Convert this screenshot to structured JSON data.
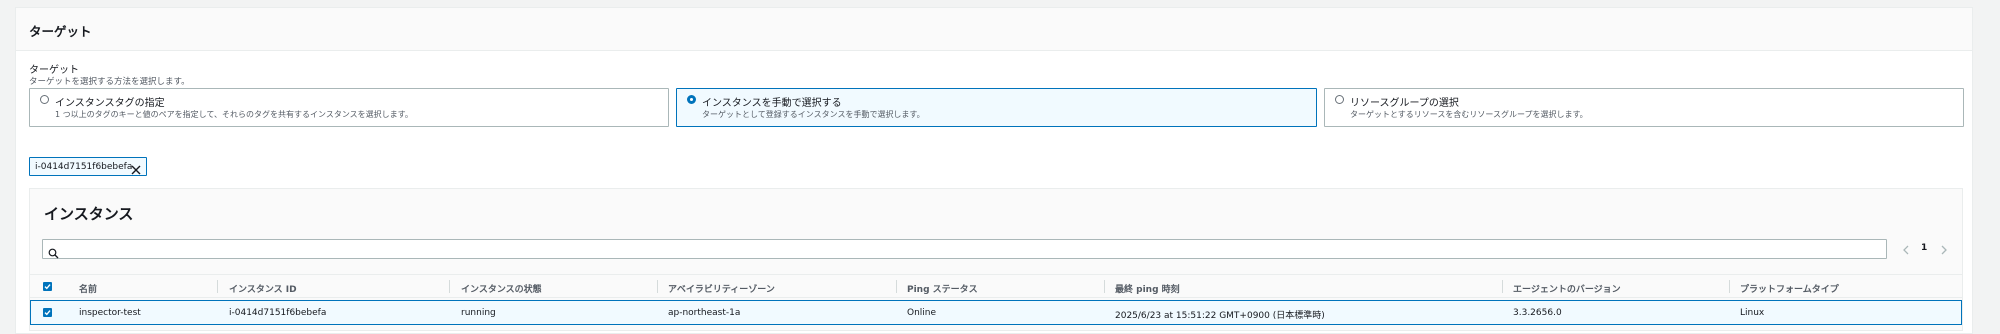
{
  "section": {
    "title": "ターゲット",
    "field_label": "ターゲット",
    "field_description": "ターゲットを選択する方法を選択します。"
  },
  "target_options": [
    {
      "label": "インスタンスタグの指定",
      "description": "1 つ以上のタグのキーと値のペアを指定して、それらのタグを共有するインスタンスを選択します。",
      "selected": false
    },
    {
      "label": "インスタンスを手動で選択する",
      "description": "ターゲットとして登録するインスタンスを手動で選択します。",
      "selected": true
    },
    {
      "label": "リソースグループの選択",
      "description": "ターゲットとするリソースを含むリソースグループを選択します。",
      "selected": false
    }
  ],
  "selected_token": {
    "label": "i-0414d7151f6bebefa"
  },
  "instances": {
    "title": "インスタンス",
    "search": {
      "value": "",
      "placeholder": ""
    },
    "pagination": {
      "current_page": "1"
    },
    "header_checkbox_checked": true,
    "columns": [
      "名前",
      "インスタンス ID",
      "インスタンスの状態",
      "アベイラビリティーゾーン",
      "Ping ステータス",
      "最終 ping 時刻",
      "エージェントのバージョン",
      "プラットフォームタイプ"
    ],
    "rows": [
      {
        "checked": true,
        "cells": [
          "inspector-test",
          "i-0414d7151f6bebefa",
          "running",
          "ap-northeast-1a",
          "Online",
          "2025/6/23 at 15:51:22 GMT+0900 (日本標準時)",
          "3.3.2656.0",
          "Linux"
        ]
      }
    ]
  },
  "colors": {
    "accent": "#0073bb",
    "selected_bg": "#f1faff",
    "border": "#aab7b8",
    "muted_text": "#545b64"
  }
}
